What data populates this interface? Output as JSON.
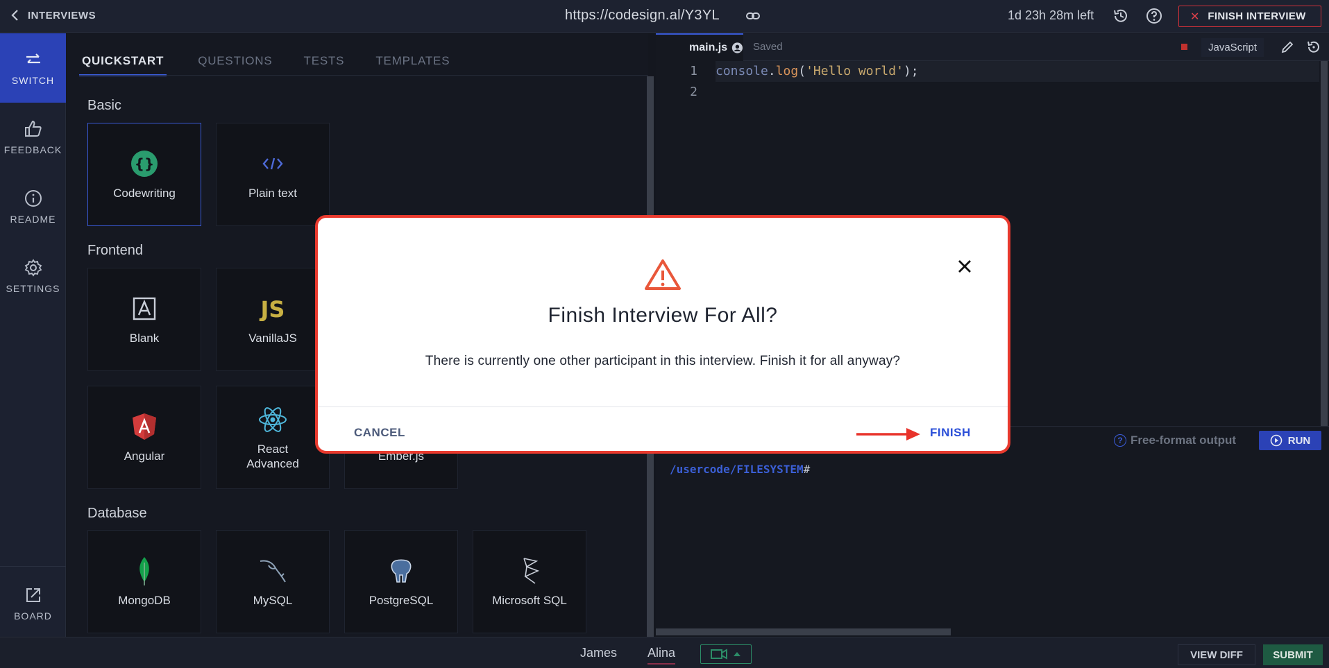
{
  "header": {
    "back_label": "INTERVIEWS",
    "url": "https://codesign.al/Y3YL",
    "time_left": "1d 23h 28m left",
    "finish_label": "FINISH INTERVIEW"
  },
  "nav": {
    "items": [
      {
        "label": "SWITCH",
        "icon": "switch-icon"
      },
      {
        "label": "FEEDBACK",
        "icon": "thumbs-up-icon"
      },
      {
        "label": "README",
        "icon": "info-icon"
      },
      {
        "label": "SETTINGS",
        "icon": "gear-icon"
      }
    ],
    "board_label": "BOARD"
  },
  "quickstart": {
    "tabs": [
      "QUICKSTART",
      "QUESTIONS",
      "TESTS",
      "TEMPLATES"
    ],
    "sections": {
      "basic": "Basic",
      "frontend": "Frontend",
      "database": "Database"
    },
    "cards": {
      "codewriting": "Codewriting",
      "plaintext": "Plain text",
      "blank": "Blank",
      "vanillajs": "VanillaJS",
      "angular": "Angular",
      "react": "React Advanced",
      "ember": "Ember.js",
      "mongodb": "MongoDB",
      "mysql": "MySQL",
      "postgresql": "PostgreSQL",
      "mssql": "Microsoft SQL"
    }
  },
  "editor": {
    "filename": "main.js",
    "status": "Saved",
    "language": "JavaScript",
    "line_numbers": [
      "1",
      "2"
    ],
    "code": {
      "obj": "console",
      "dot": ".",
      "fn": "log",
      "open": "(",
      "str": "'Hello world'",
      "close": ");"
    }
  },
  "console": {
    "mode": "Free-format output",
    "run_label": "RUN",
    "path": "/usercode/FILESYSTEM",
    "prompt": "#"
  },
  "footer": {
    "participants": [
      "James",
      "Alina"
    ],
    "view_diff": "VIEW DIFF",
    "submit": "SUBMIT"
  },
  "modal": {
    "title": "Finish Interview For All?",
    "message": "There is currently one other participant in this interview. Finish it for all anyway?",
    "cancel": "CANCEL",
    "confirm": "FINISH"
  },
  "colors": {
    "accent": "#2b42b6",
    "danger": "#e93a2e",
    "success": "#1e5a42"
  }
}
